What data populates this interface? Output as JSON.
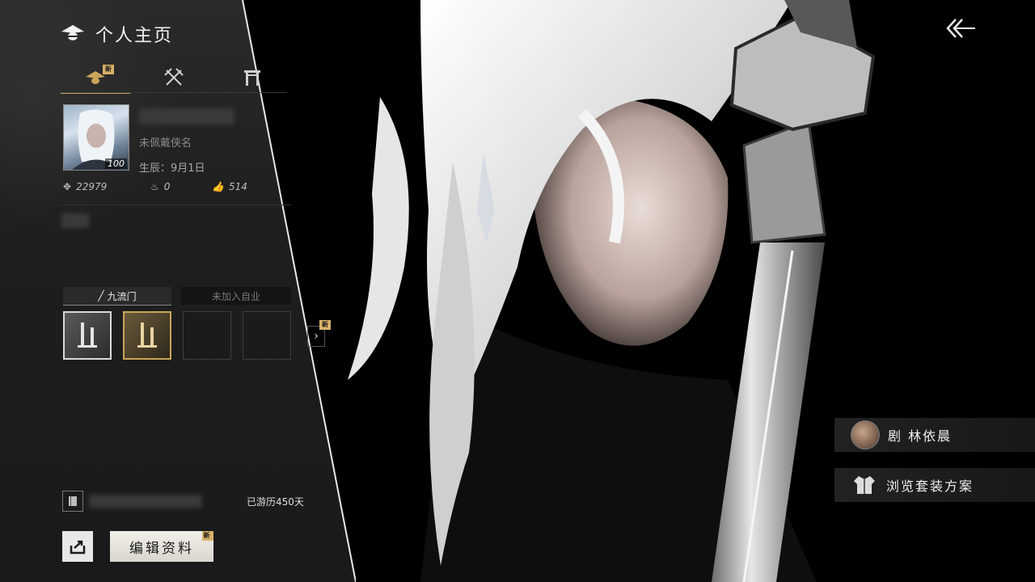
{
  "header": {
    "title": "个人主页",
    "new_badge": "新"
  },
  "tabs": [
    {
      "name": "profile",
      "icon": "bee-emblem-icon",
      "active": true,
      "badge": "新"
    },
    {
      "name": "combat",
      "icon": "crossed-swords-icon"
    },
    {
      "name": "gate",
      "icon": "gate-icon"
    }
  ],
  "profile": {
    "level": "100",
    "title_placeholder": "未佩戴侠名",
    "birthday": "生辰：9月1日",
    "stats": {
      "power": "22979",
      "heat": "0",
      "likes": "514"
    }
  },
  "sect": {
    "tab_active": "九流门",
    "tab_inactive": "未加入自业",
    "more_badge": "新"
  },
  "footer": {
    "days": "已游历450天",
    "edit_label": "编辑资料",
    "edit_badge": "新"
  },
  "right": {
    "companion_label": "剧 林依晨",
    "outfit_label": "浏览套装方案"
  },
  "colors": {
    "accent": "#c9a55a",
    "panel": "#1e1e1e"
  }
}
